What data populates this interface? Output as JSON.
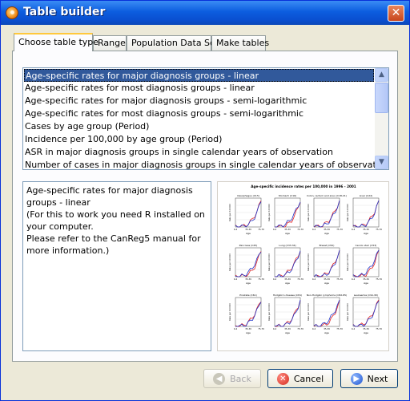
{
  "window": {
    "title": "Table builder"
  },
  "tabs": [
    {
      "label": "Choose table type",
      "active": true
    },
    {
      "label": "Range",
      "active": false
    },
    {
      "label": "Population Data Set",
      "active": false
    },
    {
      "label": "Make tables",
      "active": false
    }
  ],
  "table_types": [
    "Age-specific rates for major diagnosis groups - linear",
    "Age-specific rates for most diagnosis groups - linear",
    "Age-specific rates for major diagnosis groups - semi-logarithmic",
    "Age-specific rates for most diagnosis groups - semi-logarithmic",
    "Cases by age group (Period)",
    "Incidence per 100,000 by age group (Period)",
    "ASR in major diagnosis groups in single calendar years of observation",
    "Number of cases in major diagnosis groups in single calendar years of observation"
  ],
  "selected_index": 0,
  "description": {
    "lines": [
      "Age-specific rates for major diagnosis groups - linear",
      "(For this to work you need R installed on your computer.",
      "Please refer to the CanReg5 manual for more information.)"
    ]
  },
  "preview": {
    "title": "Age-specific incidence rates per 100,000 in 1996 - 2001",
    "panels": [
      "Oesophagus (C15)",
      "Stomach (C16)",
      "Colon, rectum and anus (C18-21)",
      "Liver (C22)",
      "Pancreas (C25)",
      "Lung (C33-34)",
      "Breast (C50)",
      "Cervix uteri (C53)",
      "Prostate (C61)",
      "Hodgkin's disease (C81)",
      "Non-Hodgkin lymphoma (C82-85)",
      "Leukaemia (C91-95)"
    ],
    "ylabel": "Rate per 100000",
    "xlabel": "Age",
    "xticks": [
      "0-4",
      "35-39",
      "75-79"
    ],
    "colors": {
      "male": "#1f33c9",
      "female": "#e02020"
    }
  },
  "buttons": {
    "back": "Back",
    "cancel": "Cancel",
    "next": "Next"
  },
  "colors": {
    "title_bar": "#0a4fd0",
    "selection": "#31599b",
    "tab_highlight": "#ffc83c"
  }
}
